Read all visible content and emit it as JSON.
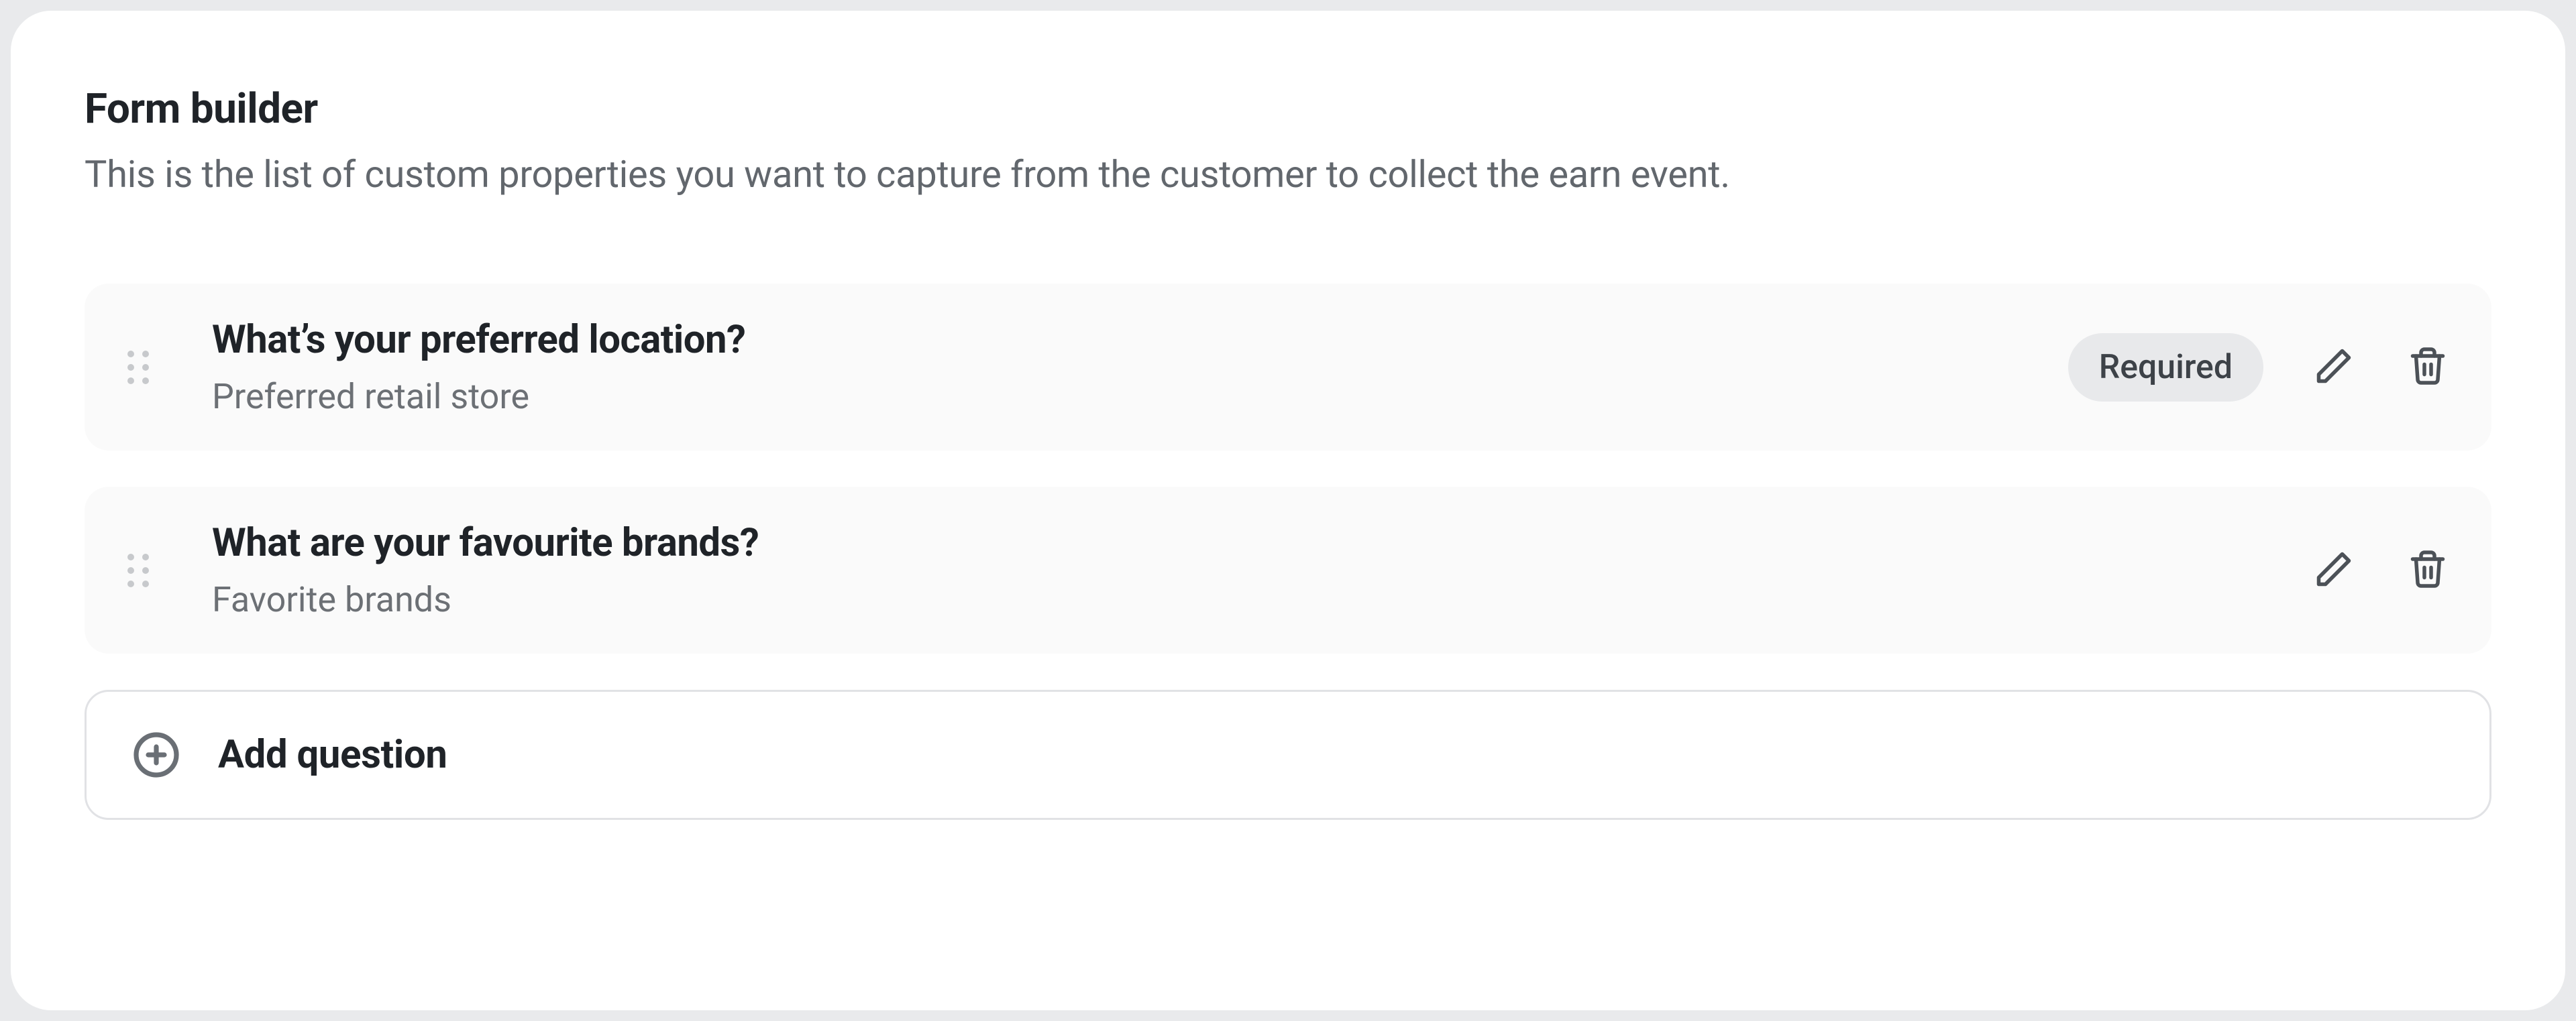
{
  "header": {
    "title": "Form builder",
    "subtitle": "This is the list of custom properties you want to capture from the customer to collect the earn event."
  },
  "questions": [
    {
      "title": "What’s your preferred location?",
      "subtitle": "Preferred retail store",
      "required_label": "Required",
      "required": true
    },
    {
      "title": "What are your favourite brands?",
      "subtitle": "Favorite brands",
      "required": false
    }
  ],
  "add_button": {
    "label": "Add question"
  }
}
